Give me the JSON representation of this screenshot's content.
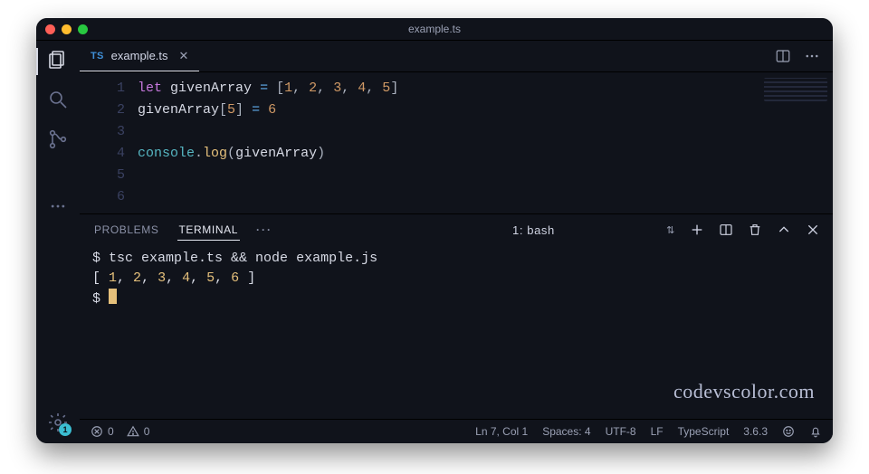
{
  "window": {
    "title": "example.ts"
  },
  "tab": {
    "lang_badge": "TS",
    "filename": "example.ts"
  },
  "code": {
    "lines": [
      "let givenArray = [1, 2, 3, 4, 5]",
      "givenArray[5] = 6",
      "",
      "console.log(givenArray)",
      "",
      ""
    ],
    "line_numbers": [
      "1",
      "2",
      "3",
      "4",
      "5",
      "6"
    ]
  },
  "panel": {
    "tabs": {
      "problems": "PROBLEMS",
      "terminal": "TERMINAL"
    },
    "select": "1: bash"
  },
  "terminal": {
    "prompt": "$",
    "command": "tsc example.ts && node example.js",
    "output": "[ 1, 2, 3, 4, 5, 6 ]"
  },
  "status": {
    "errors": "0",
    "warnings": "0",
    "cursor": "Ln 7, Col 1",
    "spaces": "Spaces: 4",
    "encoding": "UTF-8",
    "eol": "LF",
    "language": "TypeScript",
    "version": "3.6.3"
  },
  "sidebar": {
    "gear_badge": "1"
  },
  "watermark": "codevscolor.com"
}
